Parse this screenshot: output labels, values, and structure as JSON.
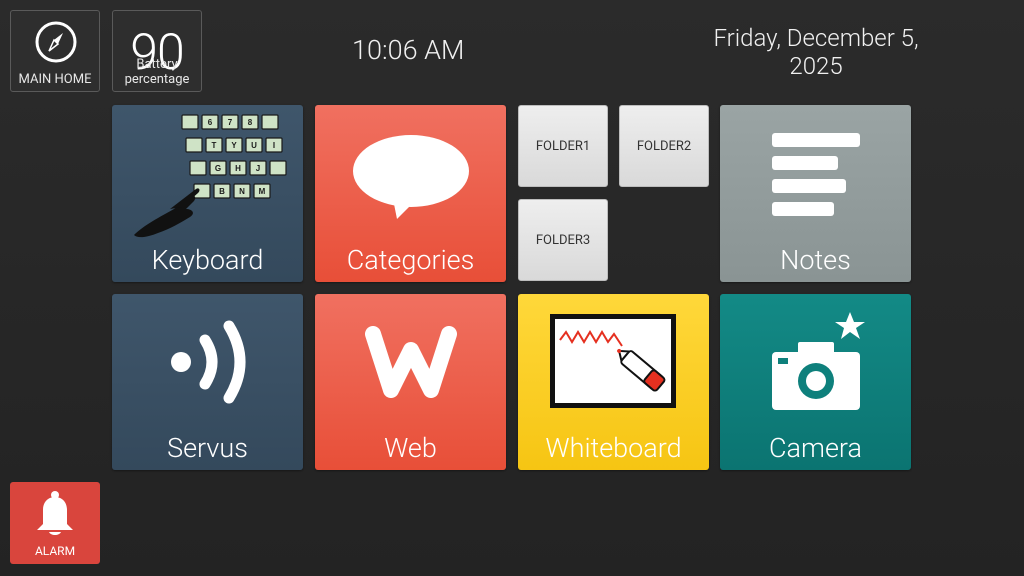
{
  "header": {
    "main_home_label": "MAIN HOME",
    "battery_value": "90",
    "battery_label": "Battery percentage",
    "time": "10:06 AM",
    "date": "Friday, December 5, 2025"
  },
  "tiles": {
    "keyboard": "Keyboard",
    "categories": "Categories",
    "notes": "Notes",
    "servus": "Servus",
    "web": "Web",
    "whiteboard": "Whiteboard",
    "camera": "Camera"
  },
  "folders": [
    "FOLDER1",
    "FOLDER2",
    "FOLDER3"
  ],
  "keyboard_keys": {
    "row1": [
      "6",
      "7",
      "8",
      ""
    ],
    "row2": [
      "T",
      "Y",
      "U",
      "I"
    ],
    "row3": [
      "G",
      "H",
      "J",
      ""
    ],
    "row4": [
      "B",
      "N",
      "M",
      ""
    ]
  },
  "alarm_label": "ALARM",
  "icons": {
    "main_home": "compass-icon",
    "keyboard": "keyboard-pointing-hand-icon",
    "categories": "speech-bubble-icon",
    "notes": "notes-lines-icon",
    "servus": "signal-waves-icon",
    "web": "web-w-icon",
    "whiteboard": "whiteboard-marker-icon",
    "camera": "camera-icon",
    "alarm": "bell-icon"
  },
  "colors": {
    "background": "#262626",
    "tile_blue": "#3a5063",
    "tile_red": "#ea5a44",
    "tile_gray": "#929c9c",
    "tile_yellow": "#f9cc1f",
    "tile_teal": "#0e807c",
    "alarm_red": "#d9453d"
  }
}
